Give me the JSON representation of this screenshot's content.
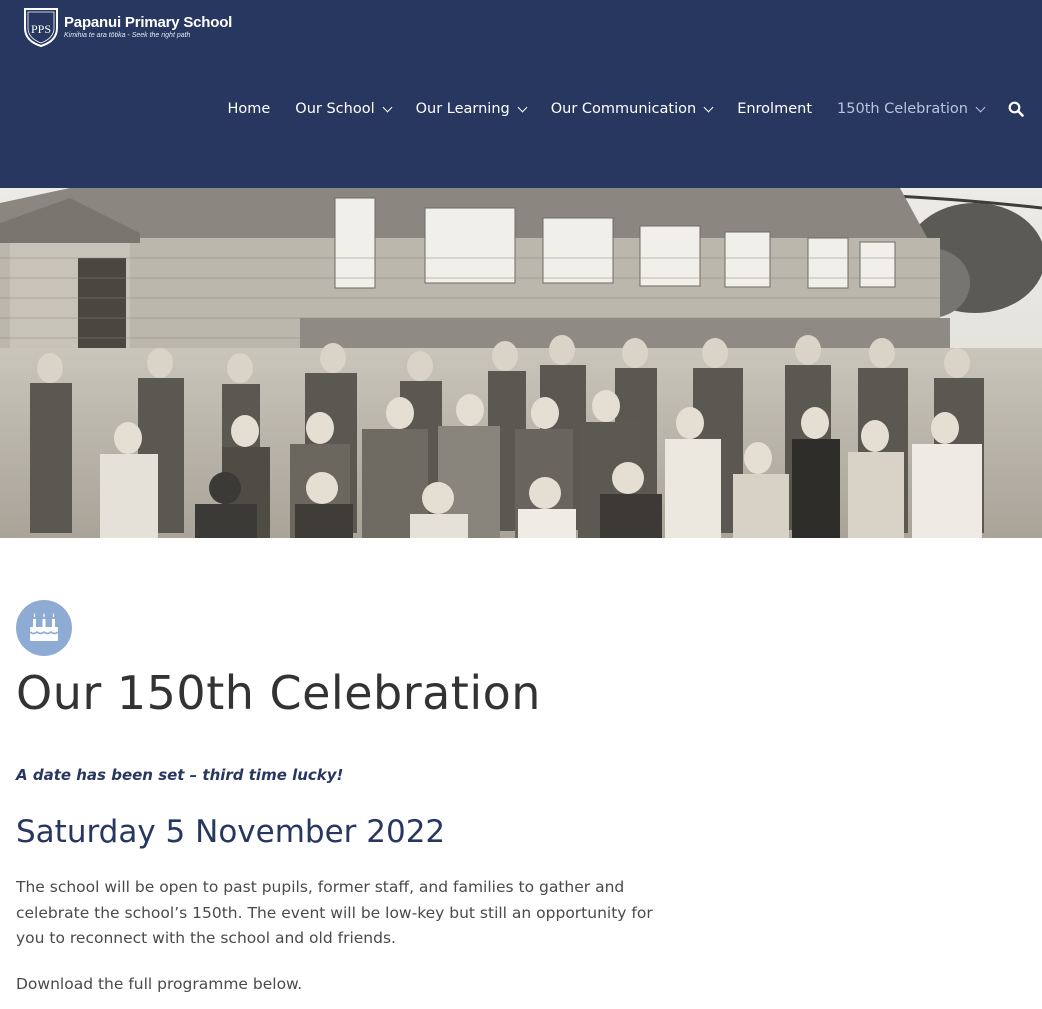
{
  "header": {
    "logo": {
      "monogram": "PPS",
      "name": "Papanui Primary School",
      "motto": "Kimihia te ara tōtika - Seek the right path"
    },
    "nav": [
      {
        "label": "Home",
        "has_dropdown": false
      },
      {
        "label": "Our School",
        "has_dropdown": true
      },
      {
        "label": "Our Learning",
        "has_dropdown": true
      },
      {
        "label": "Our Communication",
        "has_dropdown": true
      },
      {
        "label": "Enrolment",
        "has_dropdown": false
      },
      {
        "label": "150th Celebration",
        "has_dropdown": true,
        "active": true
      }
    ],
    "search_icon": "search-icon"
  },
  "hero": {
    "image": "sepia-vintage-school-class-photo"
  },
  "main": {
    "badge_icon": "birthday-cake-icon",
    "title": "Our 150th Celebration",
    "tagline": "A date has been set – third time lucky!",
    "date": "Saturday 5 November 2022",
    "paragraph1": "The school will be open to past pupils, former staff, and families to gather and celebrate the school’s 150th.  The event will be low-key but still an opportunity for you to reconnect with the school and old friends.",
    "paragraph2": "Download the full programme below."
  },
  "colors": {
    "header_bg": "#283760",
    "accent": "#8eabd4",
    "active_nav": "#b7c4dc",
    "heading": "#283760"
  }
}
